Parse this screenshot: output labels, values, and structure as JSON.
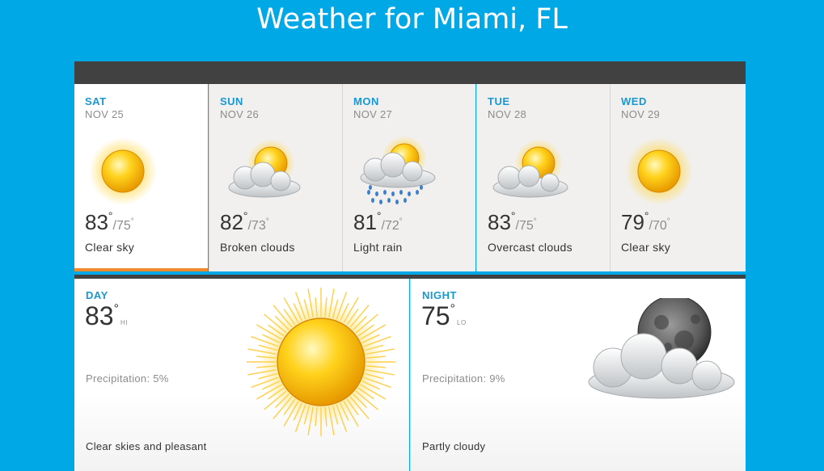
{
  "page": {
    "title": "Weather for Miami, FL"
  },
  "forecast": [
    {
      "dow": "SAT",
      "date": "NOV 25",
      "hi": "83",
      "lo": "75",
      "condition": "Clear sky",
      "icon": "sun-icon",
      "selected": true
    },
    {
      "dow": "SUN",
      "date": "NOV 26",
      "hi": "82",
      "lo": "73",
      "condition": "Broken clouds",
      "icon": "sun-behind-cloud-icon",
      "selected": false
    },
    {
      "dow": "MON",
      "date": "NOV 27",
      "hi": "81",
      "lo": "72",
      "condition": "Light rain",
      "icon": "sun-cloud-rain-icon",
      "selected": false
    },
    {
      "dow": "TUE",
      "date": "NOV 28",
      "hi": "83",
      "lo": "75",
      "condition": "Overcast clouds",
      "icon": "sun-behind-cloud-icon",
      "selected": false
    },
    {
      "dow": "WED",
      "date": "NOV 29",
      "hi": "79",
      "lo": "70",
      "condition": "Clear sky",
      "icon": "sun-icon",
      "selected": false
    }
  ],
  "degree_symbol": "°",
  "slash": "/",
  "detail": {
    "day": {
      "label": "DAY",
      "temp": "83",
      "tag": "HI",
      "precipitation": "Precipitation: 5%",
      "summary": "Clear skies and pleasant",
      "icon": "sun-icon"
    },
    "night": {
      "label": "NIGHT",
      "temp": "75",
      "tag": "LO",
      "precipitation": "Precipitation: 9%",
      "summary": "Partly cloudy",
      "icon": "moon-behind-cloud-icon"
    }
  },
  "colors": {
    "background": "#00a8e6",
    "accent": "#1898d2",
    "selected_underline": "#ee8a2c",
    "bar": "#414141"
  }
}
